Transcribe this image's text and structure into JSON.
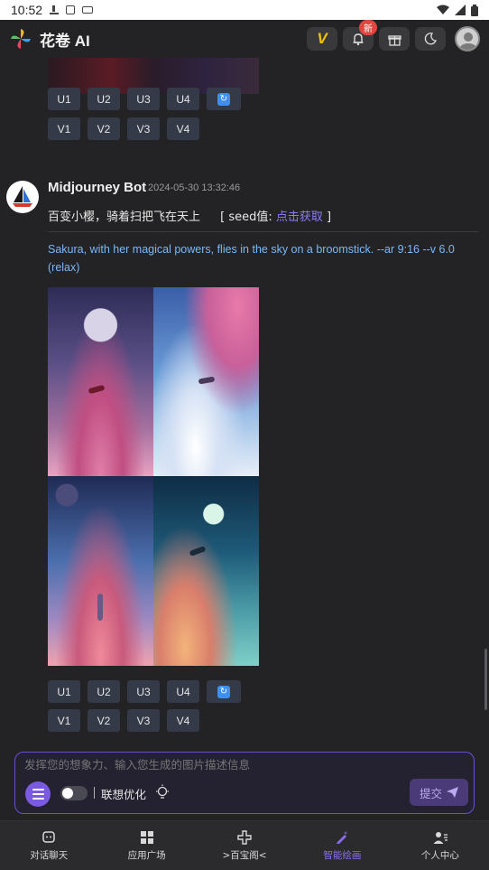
{
  "status_bar": {
    "time": "10:52"
  },
  "header": {
    "app_title": "花卷 AI",
    "vip_label": "V",
    "new_badge": "新"
  },
  "previous_message": {
    "upscale_buttons": [
      "U1",
      "U2",
      "U3",
      "U4"
    ],
    "variation_buttons": [
      "V1",
      "V2",
      "V3",
      "V4"
    ]
  },
  "message": {
    "bot_name": "Midjourney Bot",
    "timestamp": "2024-05-30 13:32:46",
    "prompt_cn": "百变小樱，骑着扫把飞在天上",
    "seed_label": "[ seed值: ",
    "seed_link": "点击获取",
    "seed_close": " ]",
    "prompt_en": "Sakura, with her magical powers, flies in the sky on a broomstick. --ar 9:16 --v 6.0  (relax)",
    "upscale_buttons": [
      "U1",
      "U2",
      "U3",
      "U4"
    ],
    "variation_buttons": [
      "V1",
      "V2",
      "V3",
      "V4"
    ]
  },
  "input": {
    "placeholder": "发挥您的想象力、输入您生成的图片描述信息",
    "assoc_label": "联想优化",
    "assoc_enabled": false,
    "submit_label": "提交"
  },
  "bottom_nav": [
    {
      "label": "对话聊天",
      "icon": "chat-icon",
      "active": false
    },
    {
      "label": "应用广场",
      "icon": "grid-icon",
      "active": false
    },
    {
      "label": ">百宝阁<",
      "icon": "puzzle-icon",
      "active": false
    },
    {
      "label": "智能绘画",
      "icon": "paint-icon",
      "active": true
    },
    {
      "label": "个人中心",
      "icon": "user-icon",
      "active": false
    }
  ],
  "colors": {
    "accent": "#8a6cf2",
    "link": "#7db8f5",
    "background": "#232325"
  }
}
